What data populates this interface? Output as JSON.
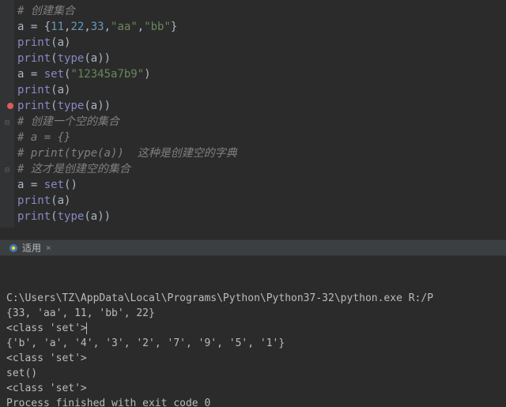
{
  "editor": {
    "lines": [
      {
        "tokens": [
          {
            "cls": "comment",
            "t": "# 创建集合"
          }
        ]
      },
      {
        "tokens": [
          {
            "cls": "ident",
            "t": "a "
          },
          {
            "cls": "punct",
            "t": "= {"
          },
          {
            "cls": "number",
            "t": "11"
          },
          {
            "cls": "punct",
            "t": ","
          },
          {
            "cls": "number",
            "t": "22"
          },
          {
            "cls": "punct",
            "t": ","
          },
          {
            "cls": "number",
            "t": "33"
          },
          {
            "cls": "punct",
            "t": ","
          },
          {
            "cls": "string",
            "t": "\"aa\""
          },
          {
            "cls": "punct",
            "t": ","
          },
          {
            "cls": "string",
            "t": "\"bb\""
          },
          {
            "cls": "punct",
            "t": "}"
          }
        ]
      },
      {
        "tokens": [
          {
            "cls": "builtin",
            "t": "print"
          },
          {
            "cls": "punct",
            "t": "("
          },
          {
            "cls": "ident",
            "t": "a"
          },
          {
            "cls": "punct",
            "t": ")"
          }
        ]
      },
      {
        "tokens": [
          {
            "cls": "builtin",
            "t": "print"
          },
          {
            "cls": "punct",
            "t": "("
          },
          {
            "cls": "builtin",
            "t": "type"
          },
          {
            "cls": "punct",
            "t": "("
          },
          {
            "cls": "ident",
            "t": "a"
          },
          {
            "cls": "punct",
            "t": "))"
          }
        ]
      },
      {
        "tokens": [
          {
            "cls": "ident",
            "t": "a "
          },
          {
            "cls": "punct",
            "t": "= "
          },
          {
            "cls": "builtin",
            "t": "set"
          },
          {
            "cls": "punct",
            "t": "("
          },
          {
            "cls": "string",
            "t": "\"12345a7b9\""
          },
          {
            "cls": "punct",
            "t": ")"
          }
        ]
      },
      {
        "tokens": [
          {
            "cls": "builtin",
            "t": "print"
          },
          {
            "cls": "punct",
            "t": "("
          },
          {
            "cls": "ident",
            "t": "a"
          },
          {
            "cls": "punct",
            "t": ")"
          }
        ]
      },
      {
        "breakpoint": true,
        "tokens": [
          {
            "cls": "builtin",
            "t": "print"
          },
          {
            "cls": "punct",
            "t": "("
          },
          {
            "cls": "builtin",
            "t": "type"
          },
          {
            "cls": "punct",
            "t": "("
          },
          {
            "cls": "ident",
            "t": "a"
          },
          {
            "cls": "punct",
            "t": "))"
          }
        ]
      },
      {
        "fold": "start",
        "tokens": [
          {
            "cls": "comment",
            "t": "# 创建一个空的集合"
          }
        ]
      },
      {
        "tokens": [
          {
            "cls": "comment",
            "t": "# a = {}"
          }
        ]
      },
      {
        "tokens": [
          {
            "cls": "comment",
            "t": "# print(type(a))  这种是创建空的字典"
          }
        ]
      },
      {
        "fold": "end",
        "tokens": [
          {
            "cls": "comment",
            "t": "# 这才是创建空的集合"
          }
        ]
      },
      {
        "tokens": [
          {
            "cls": "ident",
            "t": "a "
          },
          {
            "cls": "punct",
            "t": "= "
          },
          {
            "cls": "builtin",
            "t": "set"
          },
          {
            "cls": "punct",
            "t": "()"
          }
        ]
      },
      {
        "tokens": [
          {
            "cls": "builtin",
            "t": "print"
          },
          {
            "cls": "punct",
            "t": "("
          },
          {
            "cls": "ident",
            "t": "a"
          },
          {
            "cls": "punct",
            "t": ")"
          }
        ]
      },
      {
        "tokens": [
          {
            "cls": "builtin",
            "t": "print"
          },
          {
            "cls": "punct",
            "t": "("
          },
          {
            "cls": "builtin",
            "t": "type"
          },
          {
            "cls": "punct",
            "t": "("
          },
          {
            "cls": "ident",
            "t": "a"
          },
          {
            "cls": "punct",
            "t": "))"
          }
        ]
      }
    ]
  },
  "tab": {
    "icon": "py",
    "label": "适用",
    "close": "×"
  },
  "console": {
    "lines": [
      "C:\\Users\\TZ\\AppData\\Local\\Programs\\Python\\Python37-32\\python.exe R:/P",
      "{33, 'aa', 11, 'bb', 22}",
      "<class 'set'>",
      "{'b', 'a', '4', '3', '2', '7', '9', '5', '1'}",
      "<class 'set'>",
      "set()",
      "<class 'set'>",
      "",
      "Process finished with exit code 0"
    ],
    "caret_line": 2
  }
}
